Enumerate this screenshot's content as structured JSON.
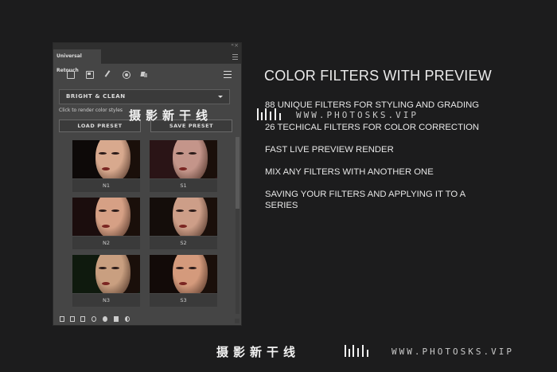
{
  "panel": {
    "tab_title": "Universal Retouch",
    "collapse_arrows": "‹‹",
    "close": "×",
    "toolbar_icons": [
      "note-icon",
      "save-icon",
      "brush-icon",
      "target-icon",
      "stack-icon",
      "hamburger-menu-icon"
    ],
    "dropdown_value": "BRIGHT & CLEAN",
    "hint": "Click to render color styles",
    "load_preset": "LOAD PRESET",
    "save_preset": "SAVE PRESET",
    "filters": [
      {
        "label": "N1",
        "tone": "#d8a98e",
        "bg": "#0d0908"
      },
      {
        "label": "S1",
        "tone": "#c4958a",
        "bg": "#2a1416"
      },
      {
        "label": "N2",
        "tone": "#d6a085",
        "bg": "#1b0d0d"
      },
      {
        "label": "S2",
        "tone": "#cd9e88",
        "bg": "#140d0a"
      },
      {
        "label": "N3",
        "tone": "#c99f80",
        "bg": "#0f1a0e"
      },
      {
        "label": "S3",
        "tone": "#d49a7c",
        "bg": "#120a08"
      }
    ],
    "bottom_icons": [
      "clipboard-icon",
      "copy-icon",
      "duplicate-icon",
      "refresh-icon",
      "gear-icon",
      "mask-icon",
      "contrast-icon"
    ]
  },
  "content": {
    "headline": "COLOR FILTERS WITH PREVIEW",
    "features": [
      "88 UNIQUE FILTERS FOR STYLING AND GRADING",
      "26 TECHICAL FILTERS FOR COLOR CORRECTION",
      "FAST LIVE PREVIEW RENDER",
      "MIX ANY FILTERS WITH ANOTHER ONE",
      "SAVING YOUR FILTERS AND APPLYING IT TO A SERIES"
    ]
  },
  "watermark": {
    "chinese": "摄影新干线",
    "url": "WWW.PHOTOSKS.VIP"
  }
}
